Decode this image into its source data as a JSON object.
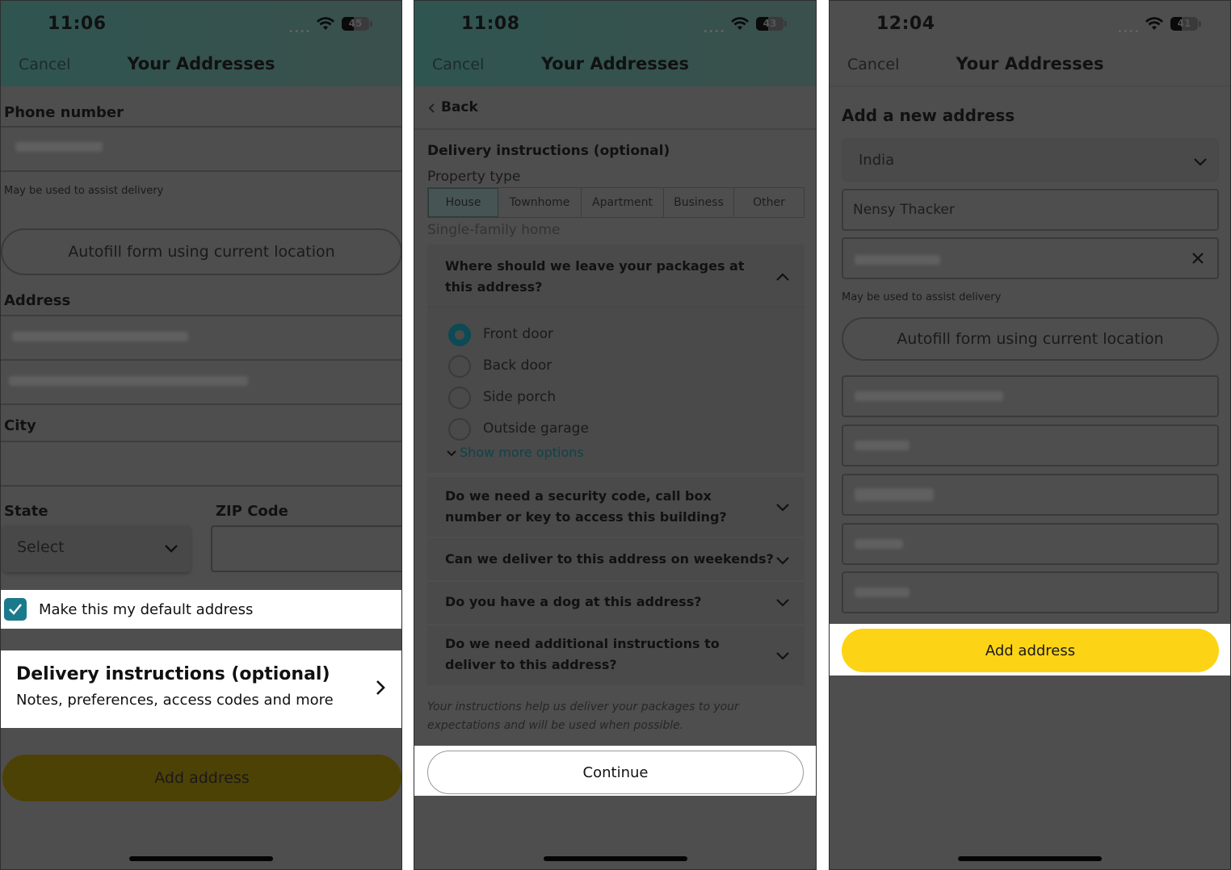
{
  "screens": [
    {
      "status": {
        "time": "11:06",
        "battery": "45",
        "battery_level": 0.45
      },
      "nav": {
        "cancel": "Cancel",
        "title": "Your Addresses"
      },
      "phone_label": "Phone number",
      "phone_value": "(redacted)",
      "phone_note": "May be used to assist delivery",
      "autofill": "Autofill form using current location",
      "address_label": "Address",
      "address_line1": "(redacted)",
      "address_line2": "(redacted)",
      "city_label": "City",
      "city_value": "",
      "state_label": "State",
      "state_value": "Select",
      "zip_label": "ZIP Code",
      "zip_value": "",
      "default_checkbox": {
        "label": "Make this my default address",
        "checked": true
      },
      "delivery": {
        "title": "Delivery instructions (optional)",
        "subtitle": "Notes, preferences, access codes and more"
      },
      "add_button": "Add address"
    },
    {
      "status": {
        "time": "11:08",
        "battery": "43",
        "battery_level": 0.43
      },
      "nav": {
        "cancel": "Cancel",
        "title": "Your Addresses"
      },
      "back": "Back",
      "section_title": "Delivery instructions (optional)",
      "property_label": "Property type",
      "property_types": [
        "House",
        "Townhome",
        "Apartment",
        "Business",
        "Other"
      ],
      "property_selected": "House",
      "property_description": "Single-family home",
      "leave_question": "Where should we leave your packages at this address?",
      "leave_options": [
        {
          "label": "Front door",
          "selected": true
        },
        {
          "label": "Back door",
          "selected": false
        },
        {
          "label": "Side porch",
          "selected": false
        },
        {
          "label": "Outside garage",
          "selected": false
        }
      ],
      "show_more": "Show more options",
      "questions": [
        "Do we need a security code, call box number or key to access this building?",
        "Can we deliver to this address on weekends?",
        "Do you have a dog at this address?",
        "Do we need additional instructions to deliver to this address?"
      ],
      "footnote": "Your instructions help us deliver your packages to your expectations and will be used when possible.",
      "continue": "Continue"
    },
    {
      "status": {
        "time": "12:04",
        "battery": "41",
        "battery_level": 0.41
      },
      "nav": {
        "cancel": "Cancel",
        "title": "Your Addresses"
      },
      "heading": "Add a new address",
      "country": "India",
      "full_name": "Nensy Thacker",
      "phone_value": "(redacted)",
      "phone_note": "May be used to assist delivery",
      "autofill": "Autofill form using current location",
      "fields": [
        "(redacted)",
        "(redacted)",
        "(redacted)",
        "(redacted)",
        "(redacted)"
      ],
      "add_button": "Add address"
    }
  ],
  "colors": {
    "accent_teal": "#1a7a8c",
    "add_button_yellow": "#fcd415",
    "overlay_gray": "#4e4e4e"
  }
}
